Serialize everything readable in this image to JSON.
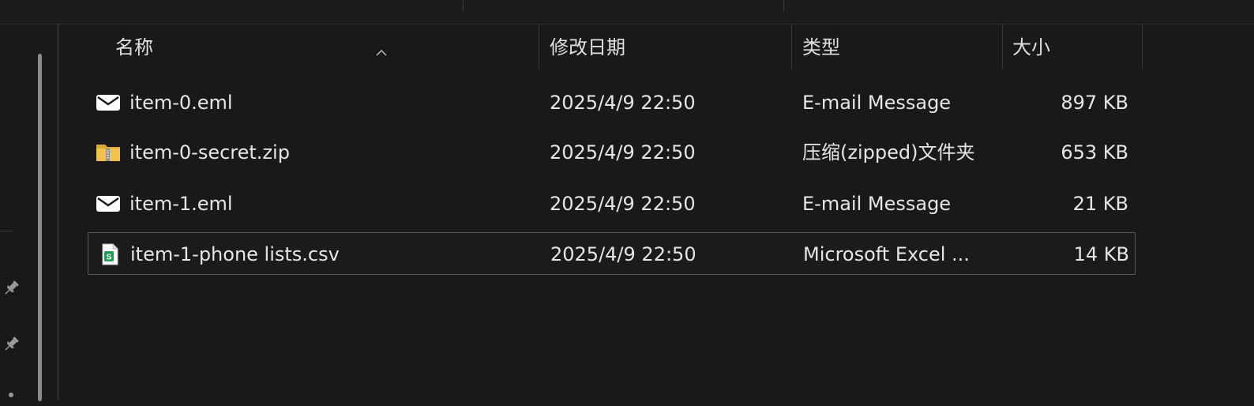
{
  "columns": {
    "name": "名称",
    "modified": "修改日期",
    "type": "类型",
    "size": "大小"
  },
  "files": [
    {
      "name": "item-0.eml",
      "modified": "2025/4/9 22:50",
      "type": "E-mail Message",
      "size": "897 KB",
      "icon": "mail-icon"
    },
    {
      "name": "item-0-secret.zip",
      "modified": "2025/4/9 22:50",
      "type": "压缩(zipped)文件夹",
      "size": "653 KB",
      "icon": "zip-folder-icon"
    },
    {
      "name": "item-1.eml",
      "modified": "2025/4/9 22:50",
      "type": "E-mail Message",
      "size": "21 KB",
      "icon": "mail-icon"
    },
    {
      "name": "item-1-phone lists.csv",
      "modified": "2025/4/9 22:50",
      "type": "Microsoft Excel ...",
      "size": "14 KB",
      "icon": "excel-csv-icon"
    }
  ],
  "colors": {
    "background": "#191919",
    "text": "#e6e6e6",
    "zip_folder": "#f2c14e",
    "excel_green": "#1f9d55"
  }
}
